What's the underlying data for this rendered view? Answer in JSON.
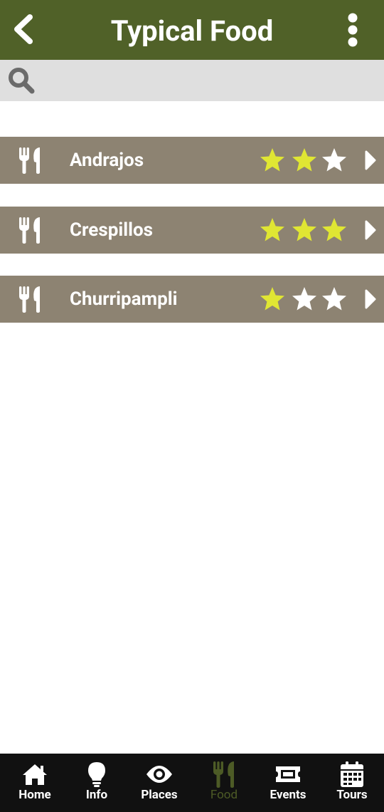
{
  "app_bar": {
    "title": "Typical Food",
    "back_icon": "chevron-left-icon",
    "menu_icon": "more-vertical-icon",
    "background": "#506128"
  },
  "search": {
    "icon": "search-icon",
    "value": "",
    "background": "#dfdfdf"
  },
  "food_list": {
    "row_background": "#8d8372",
    "star_filled_color": "#e0e633",
    "star_empty_color": "#ffffff",
    "max_rating": 3,
    "items": [
      {
        "name": "Andrajos",
        "rating": 2,
        "icon": "fork-knife-icon"
      },
      {
        "name": "Crespillos",
        "rating": 3,
        "icon": "fork-knife-icon"
      },
      {
        "name": "Churripampli",
        "rating": 1,
        "icon": "fork-knife-icon"
      }
    ]
  },
  "bottom_nav": {
    "background": "#111111",
    "active_color": "#4d5b26",
    "items": [
      {
        "label": "Home",
        "icon": "home-icon",
        "active": false
      },
      {
        "label": "Info",
        "icon": "lightbulb-icon",
        "active": false
      },
      {
        "label": "Places",
        "icon": "eye-icon",
        "active": false
      },
      {
        "label": "Food",
        "icon": "fork-knife-icon",
        "active": true
      },
      {
        "label": "Events",
        "icon": "ticket-icon",
        "active": false
      },
      {
        "label": "Tours",
        "icon": "calendar-icon",
        "active": false
      }
    ]
  }
}
